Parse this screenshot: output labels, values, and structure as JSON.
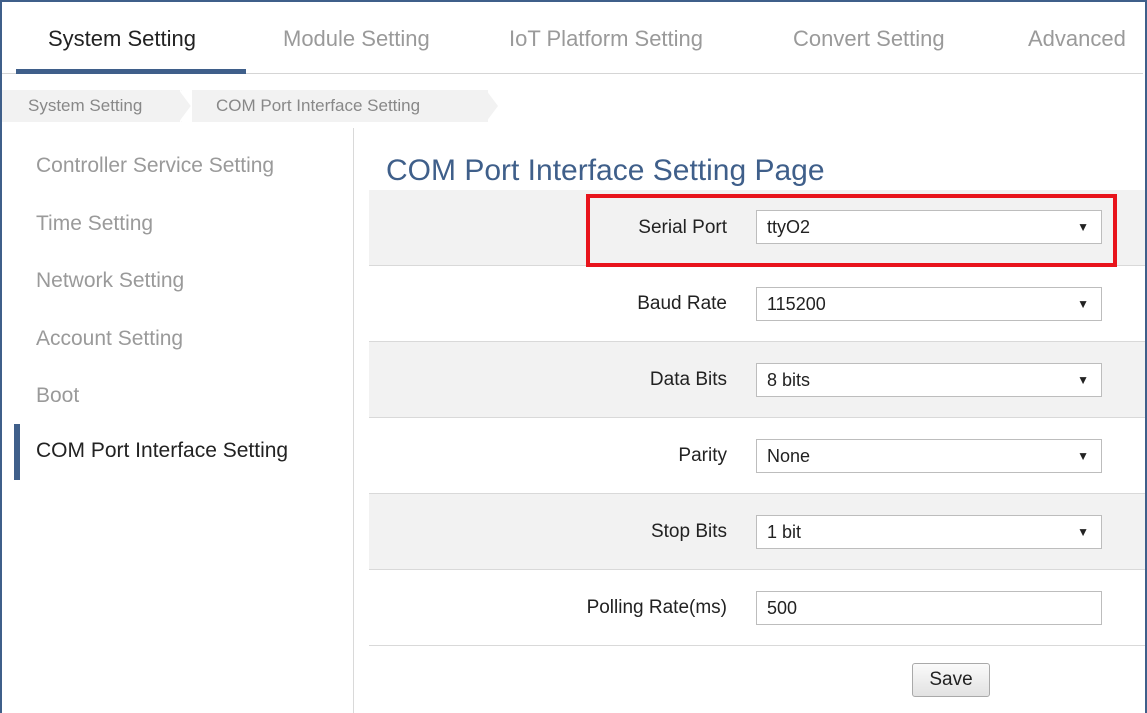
{
  "tabs": [
    {
      "label": "System Setting"
    },
    {
      "label": "Module Setting"
    },
    {
      "label": "IoT Platform Setting"
    },
    {
      "label": "Convert Setting"
    },
    {
      "label": "Advanced"
    }
  ],
  "breadcrumb": [
    {
      "label": "System Setting"
    },
    {
      "label": "COM Port Interface Setting"
    }
  ],
  "sidebar": {
    "items": [
      {
        "label": "Controller Service Setting"
      },
      {
        "label": "Time Setting"
      },
      {
        "label": "Network Setting"
      },
      {
        "label": "Account Setting"
      },
      {
        "label": "Boot"
      },
      {
        "label": "COM Port Interface Setting"
      }
    ]
  },
  "main": {
    "title": "COM Port Interface Setting Page",
    "fields": [
      {
        "label": "Serial Port",
        "value": "ttyO2"
      },
      {
        "label": "Baud Rate",
        "value": "115200"
      },
      {
        "label": "Data Bits",
        "value": "8 bits"
      },
      {
        "label": "Parity",
        "value": "None"
      },
      {
        "label": "Stop Bits",
        "value": "1 bit"
      },
      {
        "label": "Polling Rate(ms)",
        "value": "500"
      }
    ],
    "dropdown_arrow": "▼",
    "save_label": "Save"
  },
  "colors": {
    "accent": "#3f5f8a",
    "highlight": "#e8141c",
    "row_grey": "#f2f2f2"
  }
}
